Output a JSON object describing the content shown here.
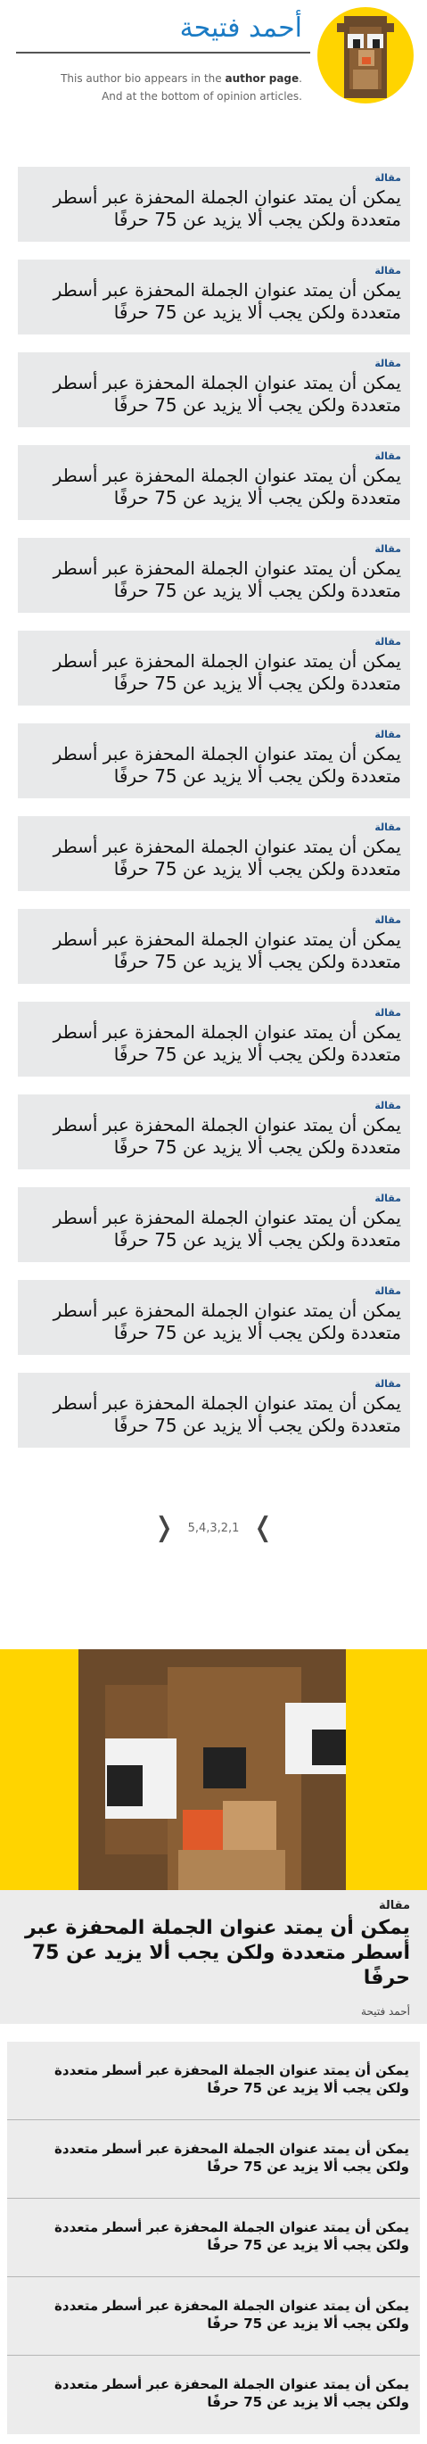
{
  "author": {
    "name": "أحمد فتيحة",
    "bio_prefix": "This author bio appears in the ",
    "bio_bold": "author page",
    "bio_suffix": ".",
    "bio_line2": "And at the bottom of opinion articles."
  },
  "articles": [
    {
      "tag": "مقالة",
      "title": "يمكن أن يمتد عنوان الجملة المحفزة عبر أسطر متعددة ولكن يجب ألا يزيد عن 75 حرفًا"
    },
    {
      "tag": "مقالة",
      "title": "يمكن أن يمتد عنوان الجملة المحفزة عبر أسطر متعددة ولكن يجب ألا يزيد عن 75 حرفًا"
    },
    {
      "tag": "مقالة",
      "title": "يمكن أن يمتد عنوان الجملة المحفزة عبر أسطر متعددة ولكن يجب ألا يزيد عن 75 حرفًا"
    },
    {
      "tag": "مقالة",
      "title": "يمكن أن يمتد عنوان الجملة المحفزة عبر أسطر متعددة ولكن يجب ألا يزيد عن 75 حرفًا"
    },
    {
      "tag": "مقالة",
      "title": "يمكن أن يمتد عنوان الجملة المحفزة عبر أسطر متعددة ولكن يجب ألا يزيد عن 75 حرفًا"
    },
    {
      "tag": "مقالة",
      "title": "يمكن أن يمتد عنوان الجملة المحفزة عبر أسطر متعددة ولكن يجب ألا يزيد عن 75 حرفًا"
    },
    {
      "tag": "مقالة",
      "title": "يمكن أن يمتد عنوان الجملة المحفزة عبر أسطر متعددة ولكن يجب ألا يزيد عن 75 حرفًا"
    },
    {
      "tag": "مقالة",
      "title": "يمكن أن يمتد عنوان الجملة المحفزة عبر أسطر متعددة ولكن يجب ألا يزيد عن 75 حرفًا"
    },
    {
      "tag": "مقالة",
      "title": "يمكن أن يمتد عنوان الجملة المحفزة عبر أسطر متعددة ولكن يجب ألا يزيد عن 75 حرفًا"
    },
    {
      "tag": "مقالة",
      "title": "يمكن أن يمتد عنوان الجملة المحفزة عبر أسطر متعددة ولكن يجب ألا يزيد عن 75 حرفًا"
    },
    {
      "tag": "مقالة",
      "title": "يمكن أن يمتد عنوان الجملة المحفزة عبر أسطر متعددة ولكن يجب ألا يزيد عن 75 حرفًا"
    },
    {
      "tag": "مقالة",
      "title": "يمكن أن يمتد عنوان الجملة المحفزة عبر أسطر متعددة ولكن يجب ألا يزيد عن 75 حرفًا"
    },
    {
      "tag": "مقالة",
      "title": "يمكن أن يمتد عنوان الجملة المحفزة عبر أسطر متعددة ولكن يجب ألا يزيد عن 75 حرفًا"
    },
    {
      "tag": "مقالة",
      "title": "يمكن أن يمتد عنوان الجملة المحفزة عبر أسطر متعددة ولكن يجب ألا يزيد عن 75 حرفًا"
    }
  ],
  "pagination": {
    "pages": "5,4,3,2,1",
    "prev_icon": "chevron-left-icon",
    "next_icon": "chevron-right-icon"
  },
  "feature": {
    "tag": "مقالة",
    "title": "يمكن أن يمتد عنوان الجملة المحفزة عبر أسطر متعددة ولكن يجب ألا يزيد عن 75 حرفًا",
    "author": "أحمد فتيحة"
  },
  "related": [
    {
      "title": "يمكن أن يمتد عنوان الجملة المحفزة عبر أسطر متعددة ولكن يجب ألا يزيد عن 75 حرفًا"
    },
    {
      "title": "يمكن أن يمتد عنوان الجملة المحفزة عبر أسطر متعددة ولكن يجب ألا يزيد عن 75 حرفًا"
    },
    {
      "title": "يمكن أن يمتد عنوان الجملة المحفزة عبر أسطر متعددة ولكن يجب ألا يزيد عن 75 حرفًا"
    },
    {
      "title": "يمكن أن يمتد عنوان الجملة المحفزة عبر أسطر متعددة ولكن يجب ألا يزيد عن 75 حرفًا"
    },
    {
      "title": "يمكن أن يمتد عنوان الجملة المحفزة عبر أسطر متعددة ولكن يجب ألا يزيد عن 75 حرفًا"
    }
  ],
  "colors": {
    "accent": "#1b7bc4",
    "tag": "#1b4f8a",
    "card_bg": "#e8e9ea",
    "avatar_bg": "#ffd400"
  }
}
